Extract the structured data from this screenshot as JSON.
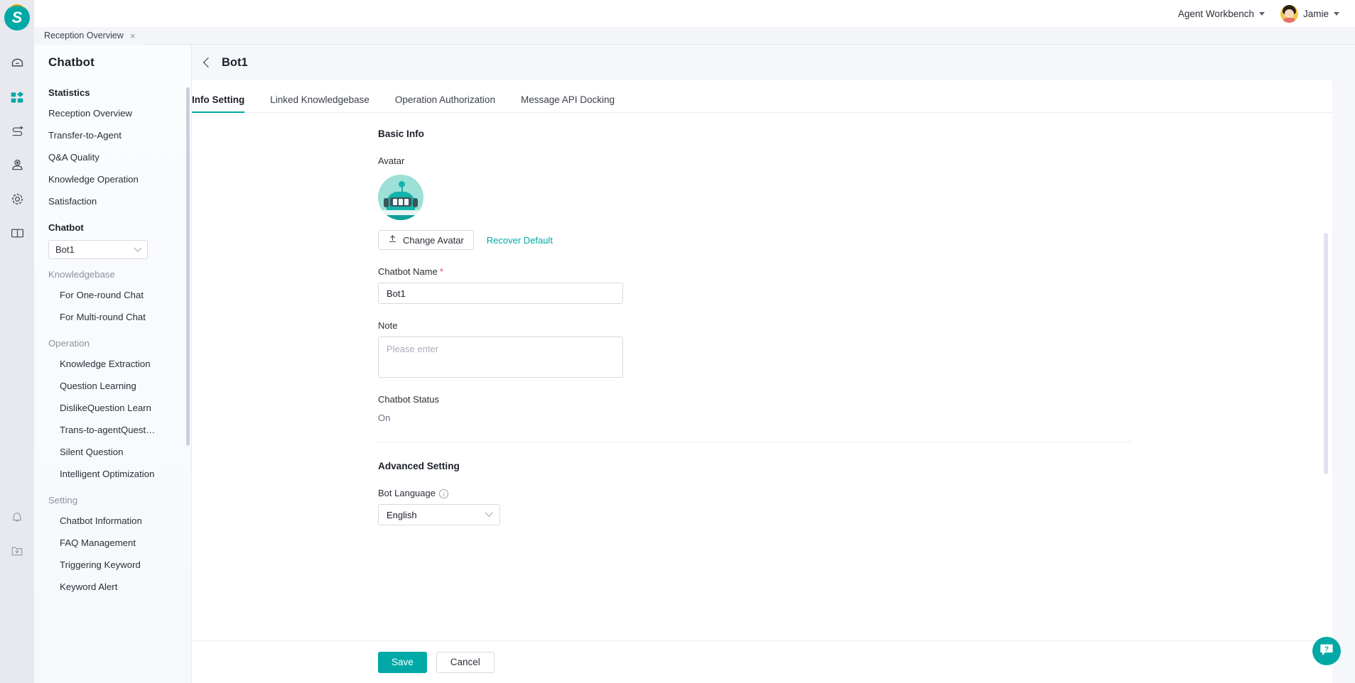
{
  "brand": {
    "logo_letter": "S",
    "accent": "#00a9a5"
  },
  "topbar": {
    "workspace_label": "Agent Workbench",
    "user_name": "Jamie"
  },
  "window_tabs": [
    {
      "label": "Reception Overview",
      "close": "×"
    }
  ],
  "rail": {
    "items": [
      {
        "name": "home-icon",
        "active": false
      },
      {
        "name": "apps-icon",
        "active": true
      },
      {
        "name": "flow-icon",
        "active": false
      },
      {
        "name": "user-location-icon",
        "active": false
      },
      {
        "name": "gear-icon",
        "active": false
      },
      {
        "name": "book-icon",
        "active": false
      }
    ],
    "bottom_items": [
      {
        "name": "bell-icon"
      },
      {
        "name": "download-folder-icon"
      }
    ]
  },
  "sidebar": {
    "title": "Chatbot",
    "groups": [
      {
        "label": "Statistics",
        "muted": false,
        "items": [
          "Reception Overview",
          "Transfer-to-Agent",
          "Q&A Quality",
          "Knowledge Operation",
          "Satisfaction"
        ]
      },
      {
        "label": "Chatbot",
        "muted": false,
        "select_value": "Bot1",
        "items": []
      },
      {
        "label": "Knowledgebase",
        "muted": true,
        "items": [
          "For One-round Chat",
          "For Multi-round Chat"
        ]
      },
      {
        "label": "Operation",
        "muted": true,
        "items": [
          "Knowledge Extraction",
          "Question Learning",
          "DislikeQuestion Learn",
          "Trans-to-agentQuest…",
          "Silent Question",
          "Intelligent Optimization"
        ]
      },
      {
        "label": "Setting",
        "muted": true,
        "items": [
          "Chatbot Information",
          "FAQ Management",
          "Triggering Keyword",
          "Keyword Alert"
        ]
      }
    ]
  },
  "main": {
    "page_title": "Bot1",
    "tabs": [
      {
        "label": "Info Setting",
        "active": true
      },
      {
        "label": "Linked Knowledgebase",
        "active": false
      },
      {
        "label": "Operation Authorization",
        "active": false
      },
      {
        "label": "Message API Docking",
        "active": false
      }
    ],
    "basic_info": {
      "section_title": "Basic Info",
      "avatar_label": "Avatar",
      "change_avatar_label": "Change Avatar",
      "recover_default_label": "Recover Default",
      "name_label": "Chatbot Name",
      "name_required_mark": "*",
      "name_value": "Bot1",
      "note_label": "Note",
      "note_value": "",
      "note_placeholder": "Please enter",
      "status_label": "Chatbot Status",
      "status_value": "On"
    },
    "advanced": {
      "section_title": "Advanced Setting",
      "language_label": "Bot Language",
      "language_value": "English"
    }
  },
  "footer": {
    "save_label": "Save",
    "cancel_label": "Cancel"
  },
  "help": {
    "glyph": "?"
  }
}
